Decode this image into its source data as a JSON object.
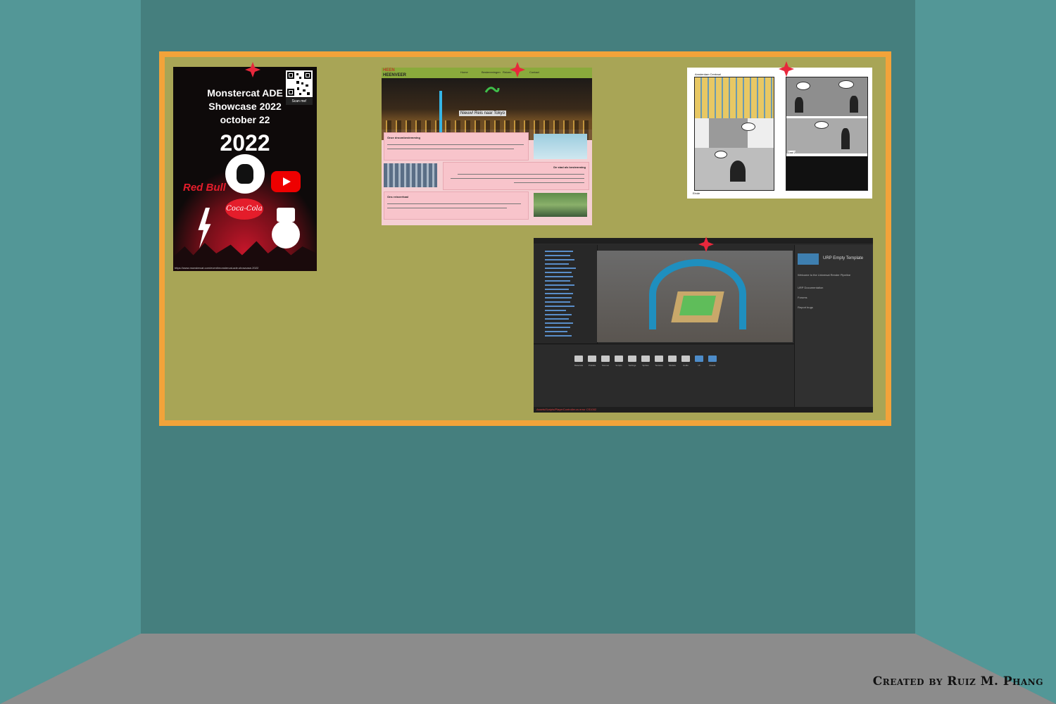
{
  "credit": "Created by Ruiz M. Phang",
  "poster": {
    "title_line1": "Monstercat ADE",
    "title_line2": "Showcase 2022",
    "title_line3": "october 22",
    "year": "2022",
    "qr_label": "Scan me!",
    "sponsor_redbull": "Red Bull",
    "sponsor_coke": "Coca-Cola",
    "url": "https://www.monstercat.com/event/monstercat-ade-showcase-2022",
    "icons": [
      "qr-code-icon",
      "monstercat-logo-icon",
      "youtube-icon",
      "lightning-bolt-icon",
      "mascot-icon"
    ]
  },
  "website": {
    "brand_line1": "HEEN",
    "brand_line2": "HEENVEER",
    "nav": [
      "Home",
      "Bestemmingen",
      "Reizen",
      "Contact"
    ],
    "hero_caption": "Nieuw! Reis naar Tokyo",
    "slider_dots": "● ● ●",
    "section1_title": "Onze droombestemming",
    "section2_title": "De stad als bestemming",
    "section3_title": "Ons reisverhaal"
  },
  "comic": {
    "caption_a": "Amsterdam Centraal",
    "caption_b": "Zaal 2",
    "caption_c": "Einde"
  },
  "unity": {
    "inspector_title": "URP Empty Template",
    "welcome_text": "Welcome to the Universal Render Pipeline",
    "docs_label": "URP Documentation",
    "forums_label": "Forums",
    "bugs_label": "Report bugs",
    "folder_labels": [
      "Materials",
      "Prefabs",
      "Scenes",
      "Scripts",
      "Settings",
      "Sprites",
      "Textures",
      "Models",
      "Audio",
      "UI",
      "Asset1",
      "Asset2"
    ],
    "status_error": "Assets/Scripts/PlayerController.cs error CS1002"
  },
  "colors": {
    "wall": "#457f7e",
    "side_wall": "#539797",
    "floor": "#8c8c8c",
    "board_frame": "#f2a33a",
    "board_surface": "#a8a556",
    "pin": "#e8283c"
  }
}
